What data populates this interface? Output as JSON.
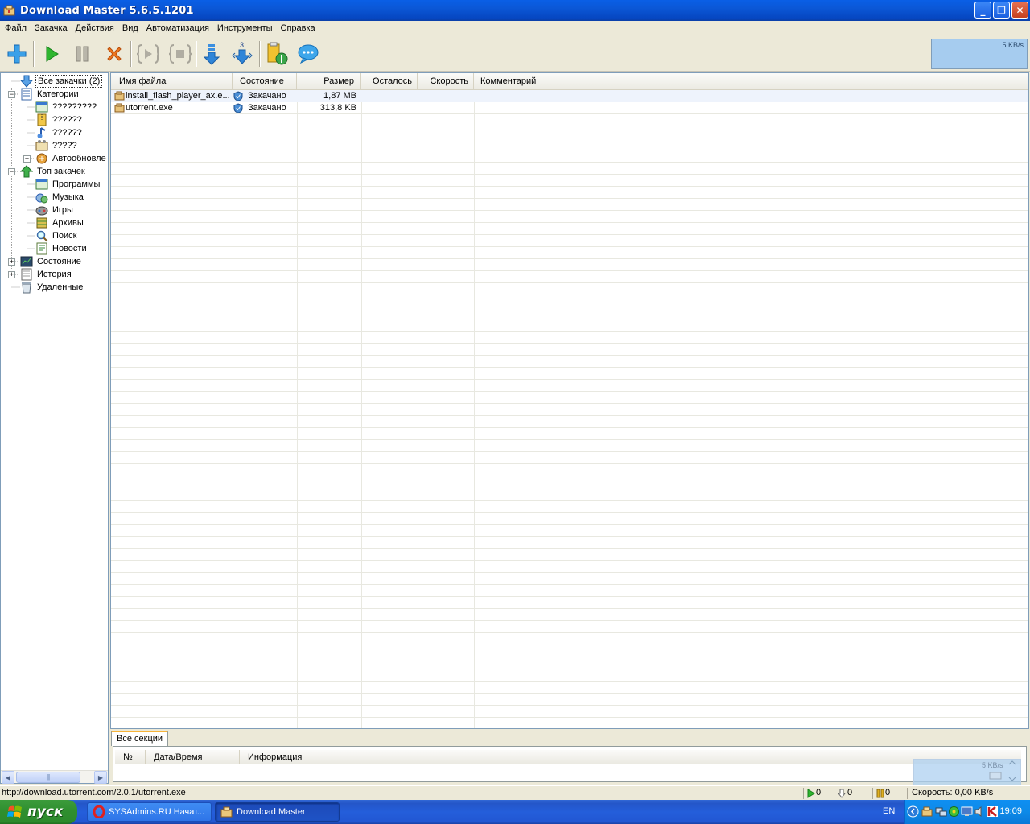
{
  "window": {
    "title": "Download Master 5.6.5.1201",
    "controls": {
      "minimize": "_",
      "maximize": "❐",
      "close": "✕"
    }
  },
  "menu": [
    "Файл",
    "Закачка",
    "Действия",
    "Вид",
    "Автоматизация",
    "Инструменты",
    "Справка"
  ],
  "toolbar": {
    "buttons": [
      "add-download",
      "start",
      "pause",
      "delete",
      "start-all",
      "stop-all",
      "download-down",
      "download-queue",
      "options",
      "chat"
    ],
    "queue_badge": "3",
    "speed_graph_label": "5 KB/s"
  },
  "tree": {
    "items": [
      {
        "label": "Все закачки (2)",
        "selected": true
      },
      {
        "label": "Категории"
      },
      {
        "label": "?????????"
      },
      {
        "label": "??????"
      },
      {
        "label": "??????"
      },
      {
        "label": "?????"
      },
      {
        "label": "Автообновле"
      },
      {
        "label": "Топ закачек"
      },
      {
        "label": "Программы"
      },
      {
        "label": "Музыка"
      },
      {
        "label": "Игры"
      },
      {
        "label": "Архивы"
      },
      {
        "label": "Поиск"
      },
      {
        "label": "Новости"
      },
      {
        "label": "Состояние"
      },
      {
        "label": "История"
      },
      {
        "label": "Удаленные"
      }
    ],
    "scroll_thumb_grip": "|||"
  },
  "downloads": {
    "columns": [
      "Имя файла",
      "Состояние",
      "Размер",
      "Осталось",
      "Скорость",
      "Комментарий"
    ],
    "rows": [
      {
        "name": "install_flash_player_ax.e...",
        "status": "Закачано",
        "size": "1,87 MB",
        "remaining": "",
        "speed": "",
        "comment": ""
      },
      {
        "name": "utorrent.exe",
        "status": "Закачано",
        "size": "313,8 KB",
        "remaining": "",
        "speed": "",
        "comment": ""
      }
    ]
  },
  "sections_panel": {
    "tab": "Все секции",
    "columns": [
      "№",
      "Дата/Время",
      "Информация"
    ],
    "mini_widget_label": "5 KB/s"
  },
  "statusbar": {
    "url": "http://download.utorrent.com/2.0.1/utorrent.exe",
    "active_count": "0",
    "queued_count": "0",
    "paused_count": "0",
    "speed": "Скорость: 0,00 KB/s"
  },
  "taskbar": {
    "start_label": "пуск",
    "tasks": [
      {
        "label": "SYSAdmins.RU Начат...",
        "active": false
      },
      {
        "label": "Download Master",
        "active": true
      }
    ],
    "language": "EN",
    "clock": "19:09"
  }
}
